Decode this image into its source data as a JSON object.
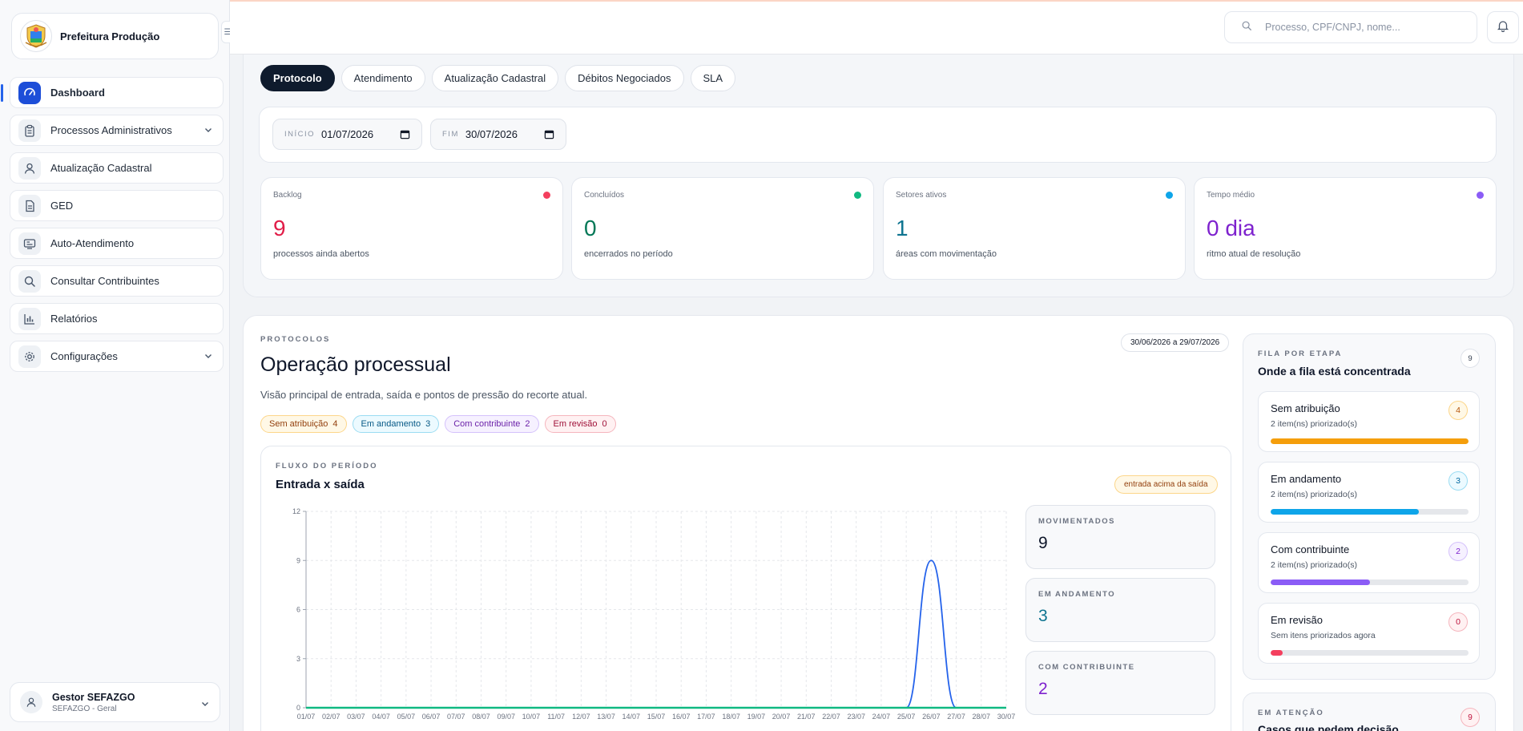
{
  "brand": {
    "title": "Prefeitura Produção"
  },
  "sidebar": {
    "items": [
      {
        "label": "Dashboard",
        "icon": "gauge-icon",
        "active": true
      },
      {
        "label": "Processos Administrativos",
        "icon": "clipboard-icon",
        "has_children": true
      },
      {
        "label": "Atualização Cadastral",
        "icon": "user-icon"
      },
      {
        "label": "GED",
        "icon": "document-icon"
      },
      {
        "label": "Auto-Atendimento",
        "icon": "kiosk-icon"
      },
      {
        "label": "Consultar Contribuintes",
        "icon": "search-icon"
      },
      {
        "label": "Relatórios",
        "icon": "bar-chart-icon"
      },
      {
        "label": "Configurações",
        "icon": "gear-icon",
        "has_children": true
      }
    ]
  },
  "user": {
    "name": "Gestor SEFAZGO",
    "role": "SEFAZGO - Geral"
  },
  "search": {
    "placeholder": "Processo, CPF/CNPJ, nome..."
  },
  "tabs": [
    {
      "label": "Protocolo",
      "active": true
    },
    {
      "label": "Atendimento"
    },
    {
      "label": "Atualização Cadastral"
    },
    {
      "label": "Débitos Negociados"
    },
    {
      "label": "SLA"
    }
  ],
  "filters": {
    "start": {
      "label": "INÍCIO",
      "value": "01/07/2026"
    },
    "end": {
      "label": "FIM",
      "value": "30/07/2026"
    }
  },
  "kpis": [
    {
      "label": "Backlog",
      "value": "9",
      "sub": "processos ainda abertos",
      "color": "#e11d48"
    },
    {
      "label": "Concluídos",
      "value": "0",
      "sub": "encerrados no período",
      "color": "#047857"
    },
    {
      "label": "Setores ativos",
      "value": "1",
      "sub": "áreas com movimentação",
      "color": "#0e7490"
    },
    {
      "label": "Tempo médio",
      "value": "0 dia",
      "sub": "ritmo atual de resolução",
      "color": "#7e22ce"
    }
  ],
  "kpi_dots": [
    "#f43f5e",
    "#10b981",
    "#0ea5e9",
    "#8b5cf6"
  ],
  "section": {
    "eyebrow": "PROTOCOLOS",
    "title": "Operação processual",
    "description": "Visão principal de entrada, saída e pontos de pressão do recorte atual.",
    "range": "30/06/2026 a 29/07/2026"
  },
  "chips": [
    {
      "label": "Sem atribuição",
      "count": "4",
      "bg": "#fff8e6",
      "border": "#fcd68a",
      "color": "#92400e"
    },
    {
      "label": "Em andamento",
      "count": "3",
      "bg": "#ecfaff",
      "border": "#9bdcf2",
      "color": "#075985"
    },
    {
      "label": "Com contribuinte",
      "count": "2",
      "bg": "#f6f1ff",
      "border": "#d4c1fb",
      "color": "#6b21a8"
    },
    {
      "label": "Em revisão",
      "count": "0",
      "bg": "#fff1f2",
      "border": "#f5b5bd",
      "color": "#9f1239"
    }
  ],
  "flow": {
    "eyebrow": "FLUXO DO PERÍODO",
    "title": "Entrada x saída",
    "badge": "entrada acima da saída"
  },
  "chart_data": {
    "type": "line",
    "x": [
      "01/07",
      "02/07",
      "03/07",
      "04/07",
      "05/07",
      "06/07",
      "07/07",
      "08/07",
      "09/07",
      "10/07",
      "11/07",
      "12/07",
      "13/07",
      "14/07",
      "15/07",
      "16/07",
      "17/07",
      "18/07",
      "19/07",
      "20/07",
      "21/07",
      "22/07",
      "23/07",
      "24/07",
      "25/07",
      "26/07",
      "27/07",
      "28/07",
      "30/07"
    ],
    "series": [
      {
        "values": [
          0,
          0,
          0,
          0,
          0,
          0,
          0,
          0,
          0,
          0,
          0,
          0,
          0,
          0,
          0,
          0,
          0,
          0,
          0,
          0,
          0,
          0,
          0,
          0,
          0,
          9,
          0,
          0,
          0
        ],
        "color": "#2563eb"
      },
      {
        "values": [
          0,
          0,
          0,
          0,
          0,
          0,
          0,
          0,
          0,
          0,
          0,
          0,
          0,
          0,
          0,
          0,
          0,
          0,
          0,
          0,
          0,
          0,
          0,
          0,
          0,
          0,
          0,
          0,
          0
        ],
        "color": "#10b981"
      }
    ],
    "yticks": [
      "0",
      "3",
      "6",
      "9",
      "12"
    ],
    "ylim": [
      0,
      12
    ],
    "grid": true
  },
  "mini_stats": [
    {
      "label": "MOVIMENTADOS",
      "value": "9",
      "color": "#0f172a"
    },
    {
      "label": "EM ANDAMENTO",
      "value": "3",
      "color": "#0e7490"
    },
    {
      "label": "COM CONTRIBUINTE",
      "value": "2",
      "color": "#7e22ce"
    }
  ],
  "queue": {
    "eyebrow": "FILA POR ETAPA",
    "title": "Onde a fila está concentrada",
    "count": "9",
    "items": [
      {
        "name": "Sem atribuição",
        "sub": "2 item(ns) priorizado(s)",
        "count": "4",
        "level": 1.0,
        "color": "#f59e0b",
        "badge_border": "#fcd68a",
        "badge_bg": "#fff8e6",
        "badge_color": "#b45309"
      },
      {
        "name": "Em andamento",
        "sub": "2 item(ns) priorizado(s)",
        "count": "3",
        "level": 0.75,
        "color": "#0ea5e9",
        "badge_border": "#9bdcf2",
        "badge_bg": "#ecfaff",
        "badge_color": "#0369a1"
      },
      {
        "name": "Com contribuinte",
        "sub": "2 item(ns) priorizado(s)",
        "count": "2",
        "level": 0.5,
        "color": "#8b5cf6",
        "badge_border": "#d4c1fb",
        "badge_bg": "#f6f1ff",
        "badge_color": "#7e22ce"
      },
      {
        "name": "Em revisão",
        "sub": "Sem itens priorizados agora",
        "count": "0",
        "level": 0.06,
        "color": "#f43f5e",
        "badge_border": "#f5b5bd",
        "badge_bg": "#fff1f2",
        "badge_color": "#be123c"
      }
    ]
  },
  "attention": {
    "eyebrow": "EM ATENÇÃO",
    "title": "Casos que pedem decisão",
    "count": "9"
  }
}
